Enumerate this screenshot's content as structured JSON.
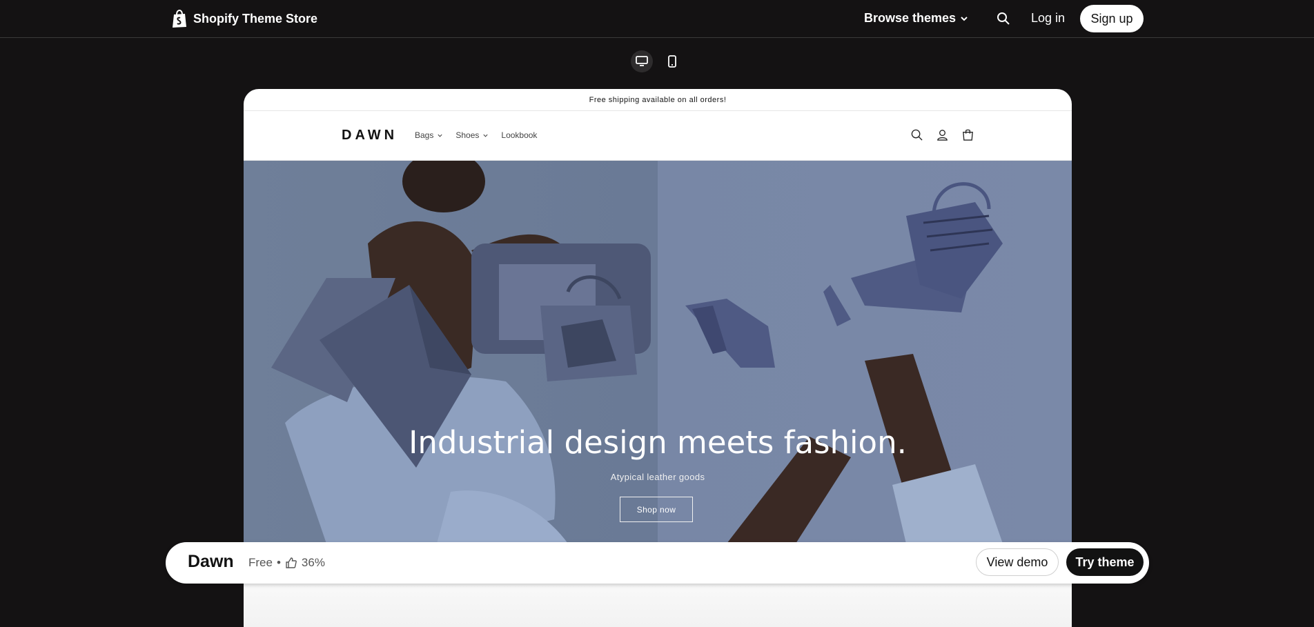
{
  "header": {
    "brand": "Shopify Theme Store",
    "browse_label": "Browse themes",
    "login_label": "Log in",
    "signup_label": "Sign up"
  },
  "device_toggle": {
    "options": [
      "desktop-icon",
      "mobile-icon"
    ],
    "selected": "desktop"
  },
  "preview": {
    "announcement": "Free shipping available on all orders!",
    "logo": "DAWN",
    "menu": [
      {
        "label": "Bags",
        "has_dropdown": true
      },
      {
        "label": "Shoes",
        "has_dropdown": true
      },
      {
        "label": "Lookbook",
        "has_dropdown": false
      }
    ],
    "icons": [
      "search-icon",
      "account-icon",
      "cart-icon"
    ],
    "hero": {
      "title": "Industrial design meets fashion.",
      "subtitle": "Atypical leather goods",
      "button": "Shop now"
    }
  },
  "bottom_bar": {
    "theme_name": "Dawn",
    "price": "Free",
    "separator": "•",
    "rating": "36%",
    "view_demo": "View demo",
    "try_theme": "Try theme"
  },
  "colors": {
    "page_bg": "#141213",
    "hero_bg": "#6f7f99",
    "accent": "#121212"
  }
}
